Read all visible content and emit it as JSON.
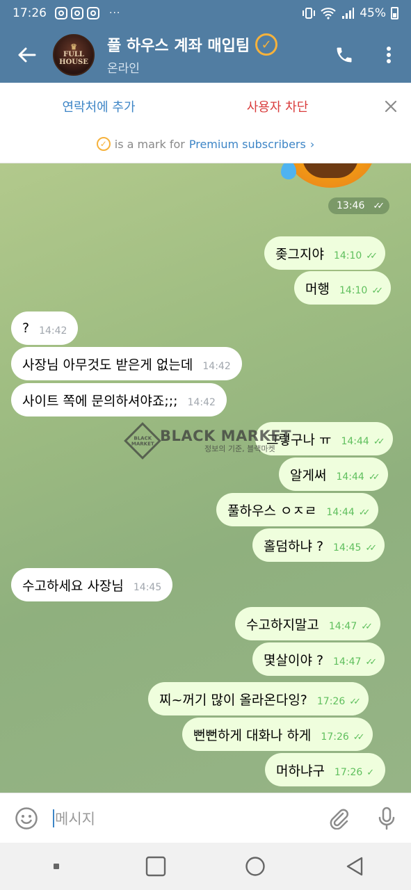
{
  "status_bar": {
    "time": "17:26",
    "dots": "···",
    "battery": "45%"
  },
  "header": {
    "title": "풀 하우스 계좌 매입팀",
    "status": "온라인",
    "avatar_text_line1": "FULL",
    "avatar_text_line2": "HOUSE"
  },
  "action_bar": {
    "add_contact": "연락처에 추가",
    "block_user": "사용자 차단",
    "premium_prefix": "is a mark for",
    "premium_link": "Premium subscribers",
    "premium_chevron": "›"
  },
  "chat": {
    "date_time_pill": "13:46",
    "messages": [
      {
        "dir": "out",
        "text": "좆그지야",
        "time": "14:10",
        "ticks": "✓✓"
      },
      {
        "dir": "out",
        "text": "머행",
        "time": "14:10",
        "ticks": "✓✓"
      },
      {
        "dir": "in",
        "text": "?",
        "time": "14:42"
      },
      {
        "dir": "in",
        "text": "사장님 아무것도 받은게 없는데",
        "time": "14:42"
      },
      {
        "dir": "in",
        "text": "사이트 쪽에 문의하셔야죠;;;",
        "time": "14:42"
      },
      {
        "dir": "out",
        "text": "그렇구나 ㅠ",
        "time": "14:44",
        "ticks": "✓✓"
      },
      {
        "dir": "out",
        "text": "알게써",
        "time": "14:44",
        "ticks": "✓✓"
      },
      {
        "dir": "out",
        "text": "풀하우스 ㅇㅈㄹ",
        "time": "14:44",
        "ticks": "✓✓"
      },
      {
        "dir": "out",
        "text": "홀덤하냐 ?",
        "time": "14:45",
        "ticks": "✓✓"
      },
      {
        "dir": "in",
        "text": "수고하세요 사장님",
        "time": "14:45"
      },
      {
        "dir": "out",
        "text": "수고하지말고",
        "time": "14:47",
        "ticks": "✓✓"
      },
      {
        "dir": "out",
        "text": "몇살이야 ?",
        "time": "14:47",
        "ticks": "✓✓"
      },
      {
        "dir": "out",
        "text": "찌~꺼기 많이 올라온다잉?",
        "time": "17:26",
        "ticks": "✓✓"
      },
      {
        "dir": "out",
        "text": "뻔뻔하게 대화나 하게",
        "time": "17:26",
        "ticks": "✓✓"
      },
      {
        "dir": "out",
        "text": "머하냐구",
        "time": "17:26",
        "ticks": "✓"
      }
    ],
    "watermark": {
      "logo_text": "BLACK MARKET",
      "title": "BLACK MARKET",
      "subtitle": "정보의 기준, 블랙마켓"
    }
  },
  "input": {
    "placeholder": "메시지"
  },
  "colors": {
    "header_bg": "#517da2",
    "out_bubble": "#effedd",
    "in_bubble": "#ffffff",
    "tick_green": "#5fbf5d",
    "link_blue": "#3d85c6",
    "block_red": "#d93c3c"
  }
}
